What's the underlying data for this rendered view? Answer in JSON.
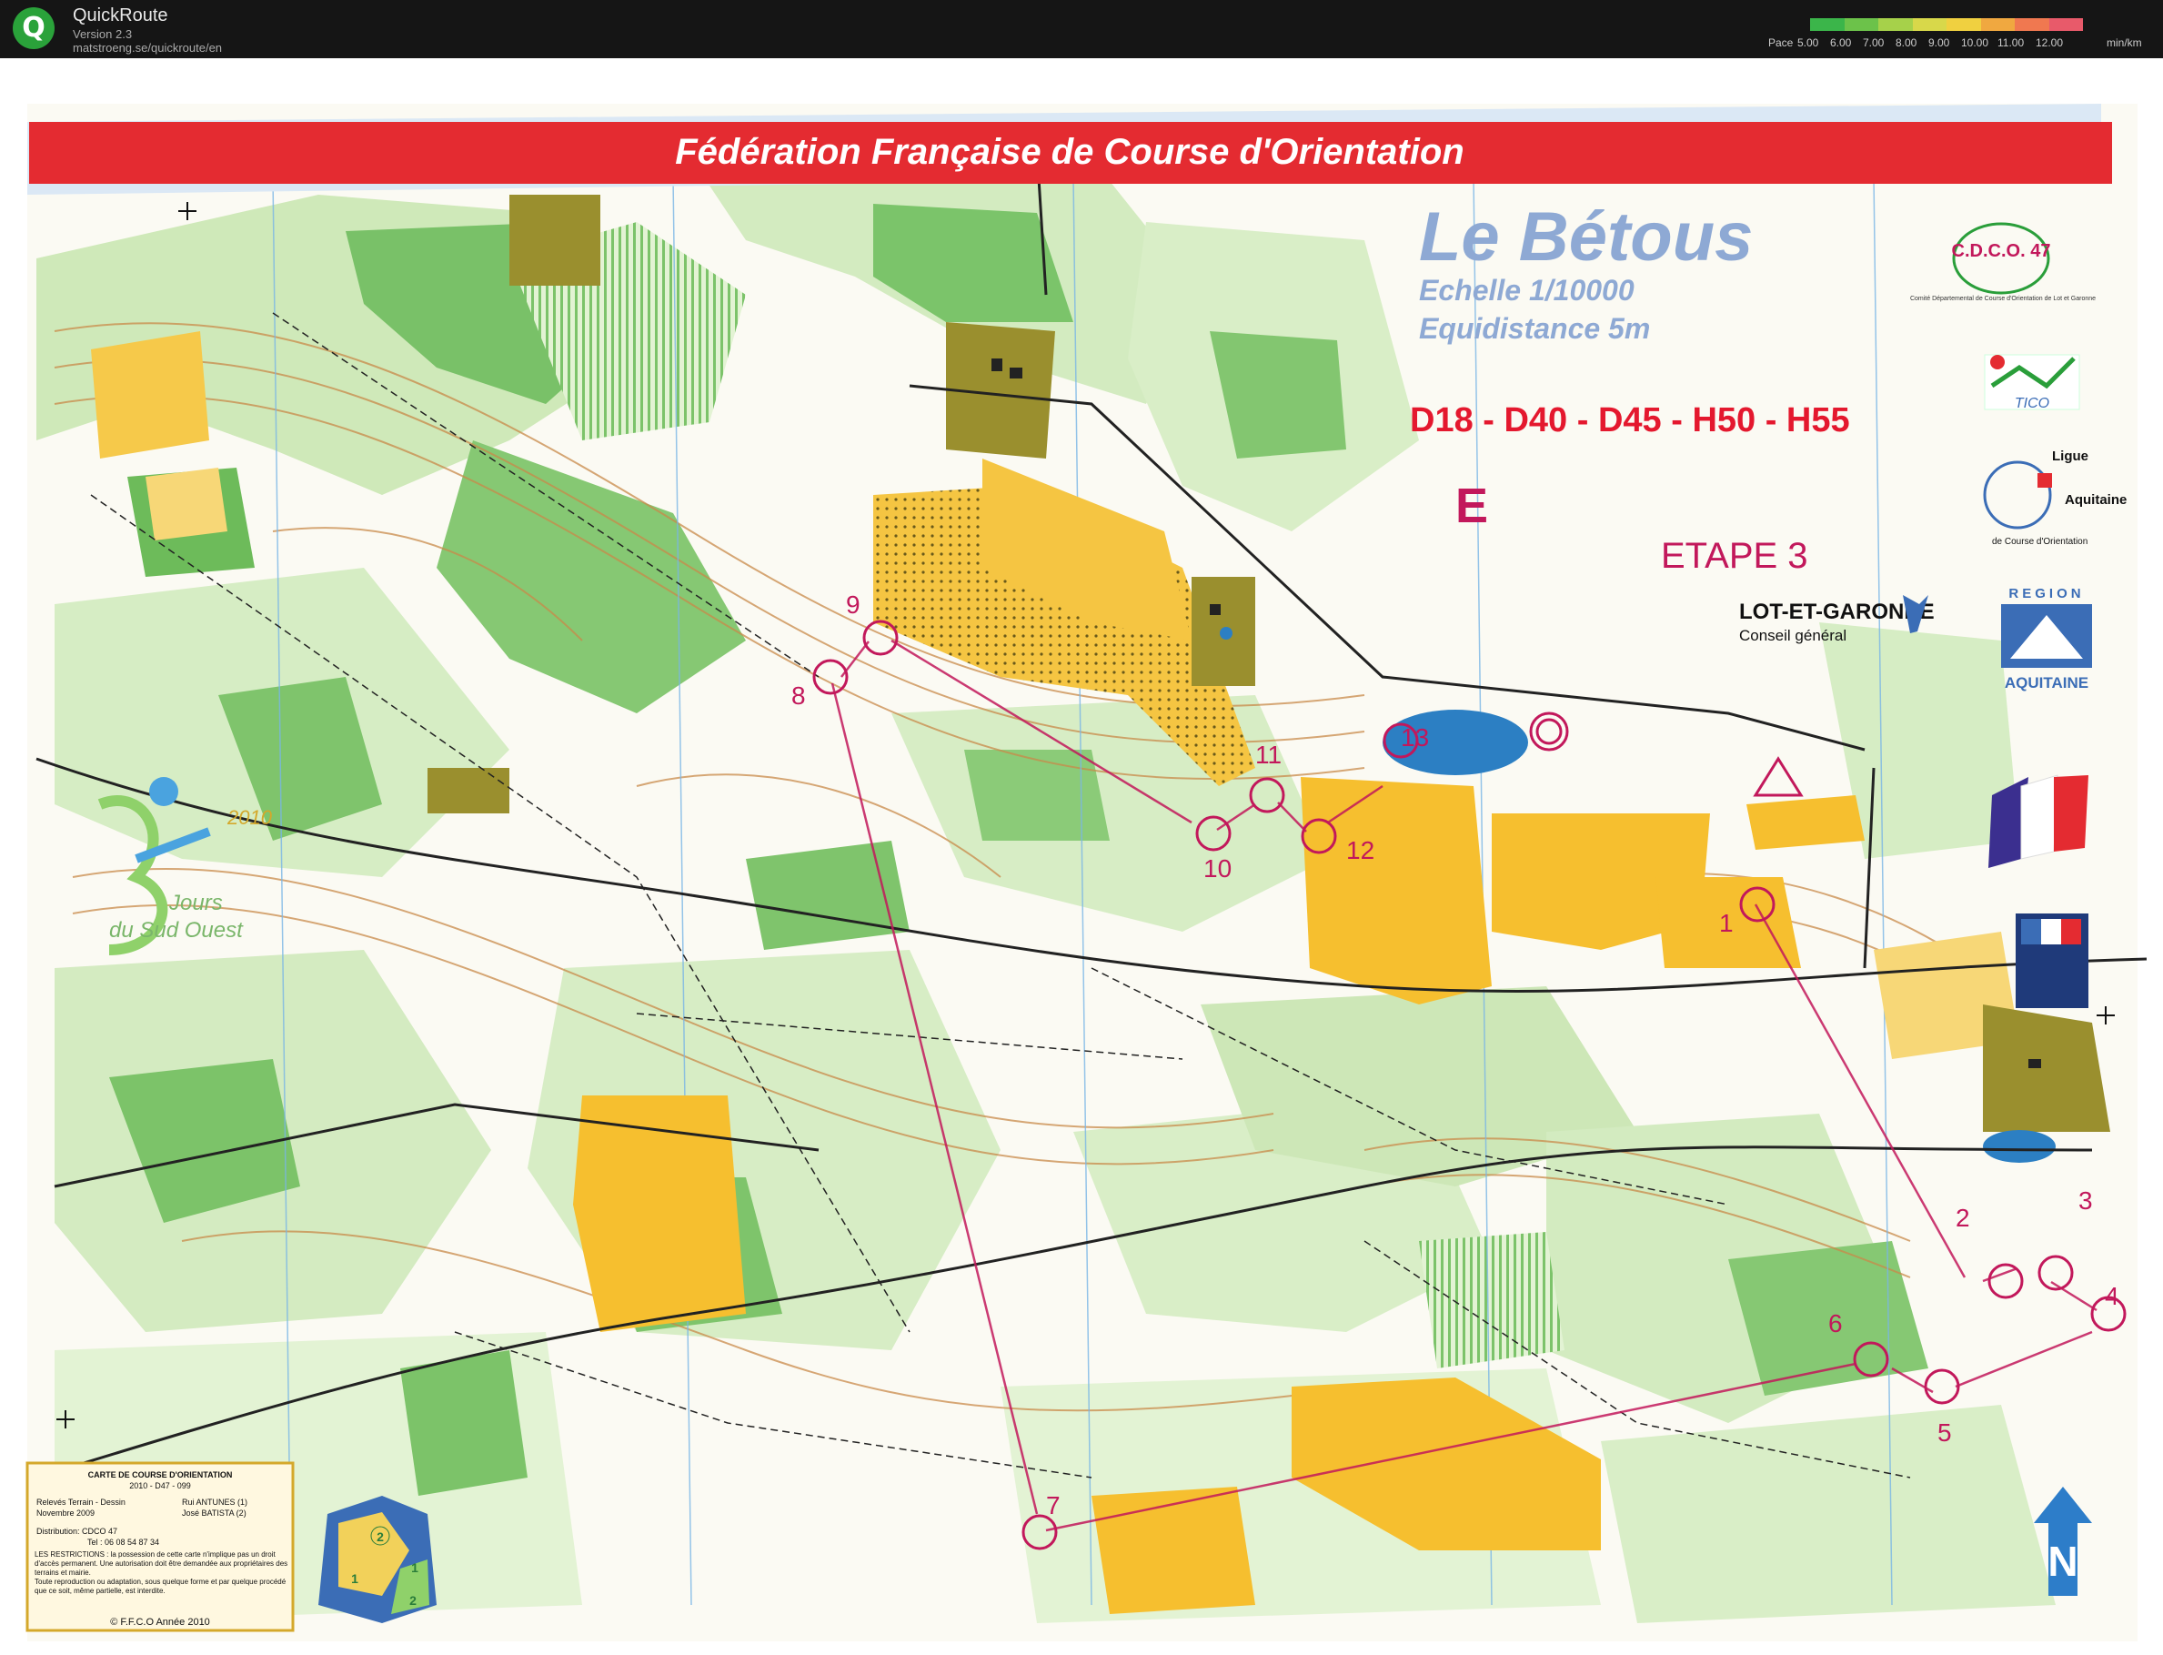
{
  "app": {
    "name": "QuickRoute",
    "version": "Version 2.3",
    "url": "matstroeng.se/quickroute/en",
    "logo_letter": "Q"
  },
  "pace_legend": {
    "label": "Pace",
    "ticks": [
      "5.00",
      "6.00",
      "7.00",
      "8.00",
      "9.00",
      "10.00",
      "11.00",
      "12.00"
    ],
    "unit": "min/km",
    "colors": [
      "#3bb54a",
      "#6cc24a",
      "#a6d14a",
      "#d8d84a",
      "#f0d040",
      "#f0a840",
      "#f07850",
      "#e85a6a"
    ]
  },
  "map": {
    "banner": "Fédération Française de Course d'Orientation",
    "title": "Le Bétous",
    "scale": "Echelle 1/10000",
    "equidistance": "Equidistance 5m",
    "categories": "D18 - D40 - D45 - H50 - H55",
    "course_letter": "E",
    "stage": "ETAPE 3",
    "sponsor_lotetgaronne": "LOT-ET-GARONNE",
    "sponsor_conseil": "Conseil général",
    "cdco_logo": "C.D.C.O. 47",
    "cdco_caption": "Comité Départemental de Course d'Orientation de Lot et Garonne",
    "ligue_1": "Ligue",
    "ligue_2": "Aquitaine",
    "ligue_3": "de Course d'Orientation",
    "region_1": "REGION",
    "region_2": "AQUITAINE",
    "tico": "TICO",
    "event_year": "2010",
    "event_line1": "Jours",
    "event_line2": "du Sud Ouest",
    "info_title": "CARTE DE COURSE D'ORIENTATION",
    "info_code": "2010 - D47 - 099",
    "info_survey": "Relevés Terrain - Dessin",
    "info_authors": "Rui ANTUNES (1)",
    "info_date": "Novembre 2009",
    "info_author2": "José BATISTA (2)",
    "info_distribution": "Distribution: CDCO 47",
    "info_tel": "Tel : 06 08 54 87 34",
    "info_restrictions": "LES RESTRICTIONS : la possession de cette carte n'implique pas un droit d'accès permanent. Une autorisation doit être demandée aux propriétaires des terrains et mairie.",
    "info_copy": "Toute reproduction ou adaptation, sous quelque forme et par quelque procédé que ce soit, même partielle, est interdite.",
    "info_copyright": "© F.F.C.O Année 2010",
    "inset_labels": [
      "2",
      "1",
      "1",
      "2"
    ],
    "north_label": "N",
    "controls": [
      "1",
      "2",
      "3",
      "4",
      "5",
      "6",
      "7",
      "8",
      "9",
      "10",
      "11",
      "12",
      "13"
    ]
  }
}
